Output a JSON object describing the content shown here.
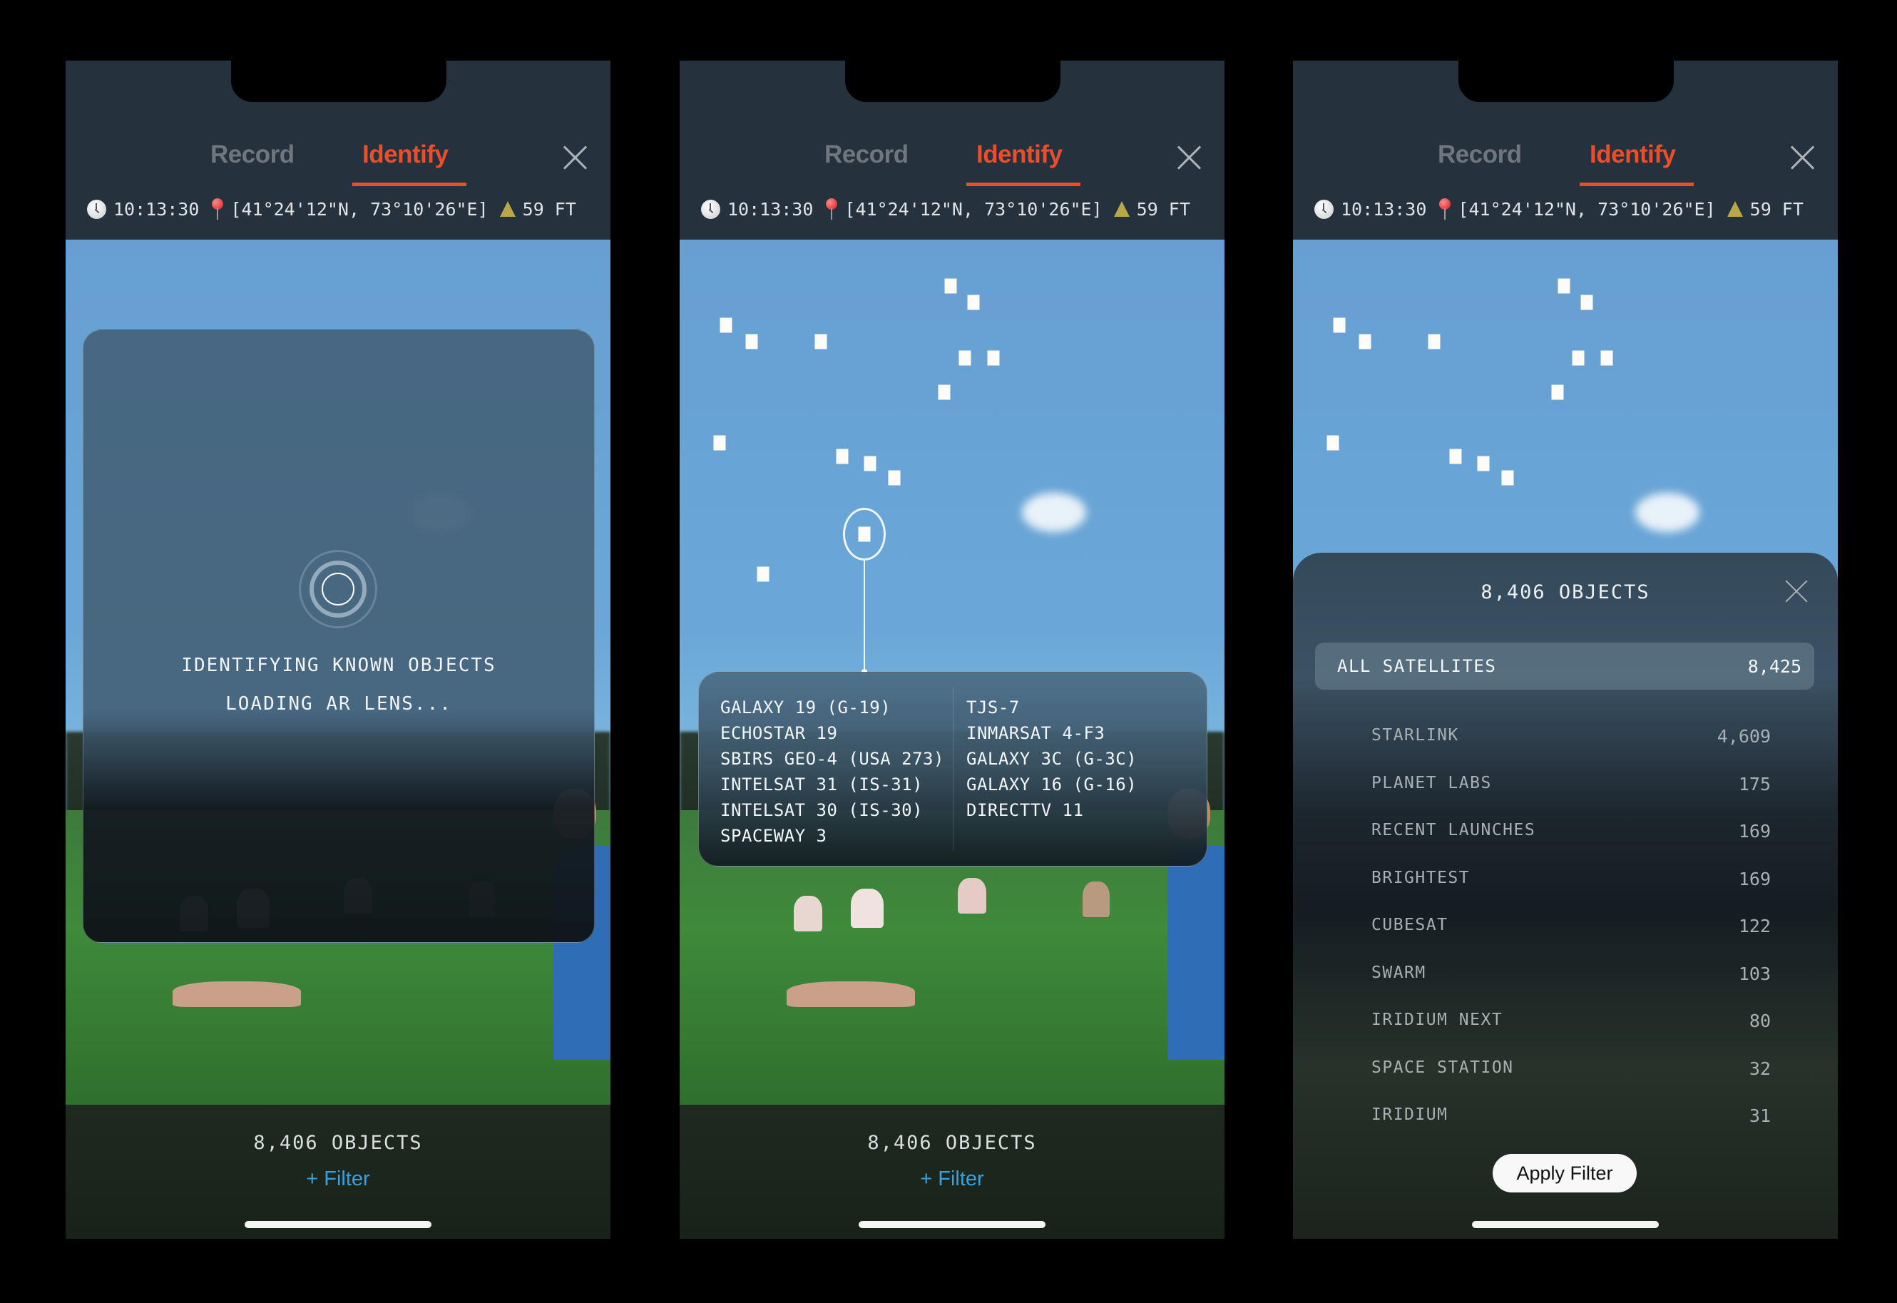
{
  "screens": [
    {
      "id": "loading",
      "tabs": [
        {
          "label": "Record",
          "active": false
        },
        {
          "label": "Identify",
          "active": true
        }
      ],
      "status": {
        "time": "10:13:30",
        "coordinates": "[41°24'12\"N, 73°10'26\"E]",
        "altitude": "59 FT",
        "icons": [
          "clock-icon",
          "location-pin-icon",
          "mountain-icon"
        ]
      },
      "loading": {
        "line1": "IDENTIFYING KNOWN OBJECTS",
        "line2": "LOADING AR LENS..."
      },
      "footer": {
        "object_count": "8,406 OBJECTS",
        "filter_label": "+ Filter"
      }
    },
    {
      "id": "identify",
      "tabs": [
        {
          "label": "Record",
          "active": false
        },
        {
          "label": "Identify",
          "active": true
        }
      ],
      "status": {
        "time": "10:13:30",
        "coordinates": "[41°24'12\"N, 73°10'26\"E]",
        "altitude": "59 FT"
      },
      "selected_objects": {
        "column_left": [
          "GALAXY 19 (G-19)",
          "ECHOSTAR 19",
          "SBIRS GEO-4 (USA 273)",
          "INTELSAT 31 (IS-31)",
          "INTELSAT 30 (IS-30)",
          "SPACEWAY 3"
        ],
        "column_right": [
          "TJS-7",
          "INMARSAT 4-F3",
          "GALAXY 3C (G-3C)",
          "GALAXY 16 (G-16)",
          "DIRECTTV 11"
        ]
      },
      "footer": {
        "object_count": "8,406 OBJECTS",
        "filter_label": "+ Filter"
      }
    },
    {
      "id": "filter",
      "tabs": [
        {
          "label": "Record",
          "active": false
        },
        {
          "label": "Identify",
          "active": true
        }
      ],
      "status": {
        "time": "10:13:30",
        "coordinates": "[41°24'12\"N, 73°10'26\"E]",
        "altitude": "59 FT"
      },
      "sheet": {
        "title": "8,406 OBJECTS",
        "all": {
          "label": "ALL SATELLITES",
          "count": "8,425",
          "selected": true
        },
        "categories": [
          {
            "label": "STARLINK",
            "count": "4,609"
          },
          {
            "label": "PLANET LABS",
            "count": "175"
          },
          {
            "label": "RECENT LAUNCHES",
            "count": "169"
          },
          {
            "label": "BRIGHTEST",
            "count": "169"
          },
          {
            "label": "CUBESAT",
            "count": "122"
          },
          {
            "label": "SWARM",
            "count": "103"
          },
          {
            "label": "IRIDIUM NEXT",
            "count": "80"
          },
          {
            "label": "SPACE STATION",
            "count": "32"
          },
          {
            "label": "IRIDIUM",
            "count": "31"
          }
        ],
        "apply_label": "Apply Filter"
      }
    }
  ],
  "colors": {
    "accent": "#ea4f2c",
    "link": "#3aa0dd",
    "header_bg": "#26313e",
    "inactive_tab": "#6f767d"
  }
}
